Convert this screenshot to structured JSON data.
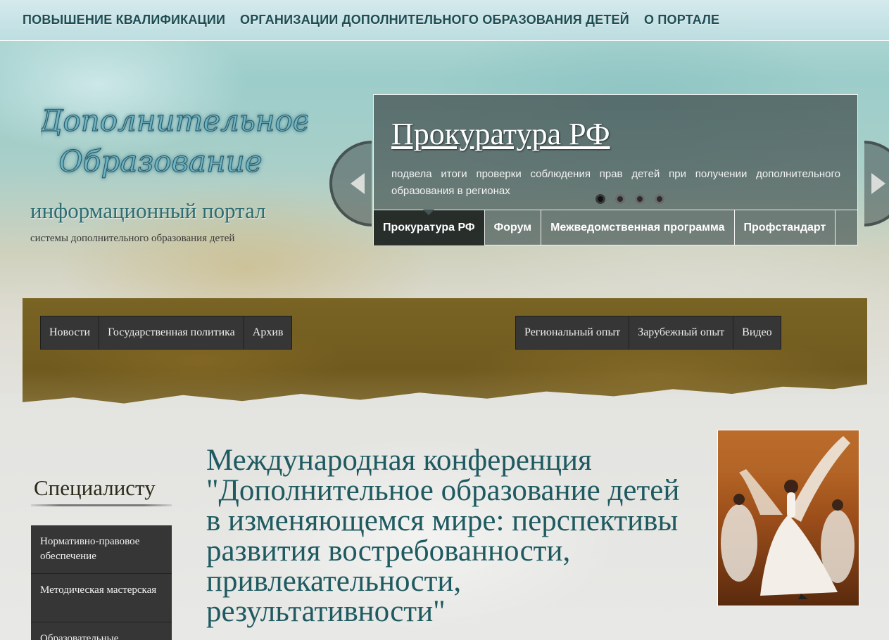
{
  "top_nav": {
    "items": [
      "ПОВЫШЕНИЕ КВАЛИФИКАЦИИ",
      "ОРГАНИЗАЦИИ ДОПОЛНИТЕЛЬНОГО ОБРАЗОВАНИЯ ДЕТЕЙ",
      "О ПОРТАЛЕ"
    ]
  },
  "branding": {
    "logo_line1": "Дополнительное",
    "logo_line2": "Образование",
    "title": "информационный портал",
    "subtitle": "системы дополнительного образования детей"
  },
  "slider": {
    "title": "Прокуратура РФ",
    "text": "подвела итоги проверки соблюдения прав детей при получении дополнительного образования в регионах",
    "dot_count": 4,
    "active_dot": 1,
    "tabs": [
      "Прокуратура РФ",
      "Форум",
      "Межведомственная программа",
      "Профстандарт"
    ],
    "active_tab": 1
  },
  "section_nav": {
    "left": [
      "Новости",
      "Государственная политика",
      "Архив"
    ],
    "right": [
      "Региональный опыт",
      "Зарубежный опыт",
      "Видео"
    ]
  },
  "sidebar": {
    "heading": "Специалисту",
    "items": [
      "Нормативно-правовое обеспечение",
      "Методическая мастерская",
      "Образовательные"
    ]
  },
  "article": {
    "title": "Международная конференция \"Дополнительное образование детей в изменяющемся мире: перспективы развития востребованности, привлекательности, результативности\""
  },
  "colors": {
    "accent_teal": "#1e5a60",
    "nav_dark": "#363636",
    "band_brown": "#7a6424"
  }
}
